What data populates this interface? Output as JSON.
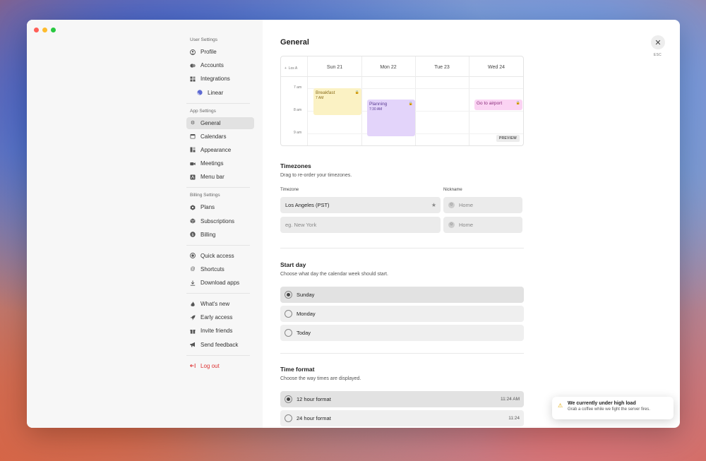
{
  "window": {
    "traffic_colors": [
      "#ff5f57",
      "#febc2e",
      "#28c840"
    ]
  },
  "sidebar": {
    "user_settings_title": "User Settings",
    "user_items": [
      {
        "label": "Profile",
        "icon": "person-icon"
      },
      {
        "label": "Accounts",
        "icon": "accounts-icon"
      },
      {
        "label": "Integrations",
        "icon": "grid-icon"
      },
      {
        "label": "Linear",
        "icon": "linear-icon"
      }
    ],
    "app_settings_title": "App Settings",
    "app_items": [
      {
        "label": "General",
        "icon": "gear-icon",
        "active": true
      },
      {
        "label": "Calendars",
        "icon": "calendar-icon"
      },
      {
        "label": "Appearance",
        "icon": "appearance-icon"
      },
      {
        "label": "Meetings",
        "icon": "video-icon"
      },
      {
        "label": "Menu bar",
        "icon": "menubar-icon"
      }
    ],
    "billing_settings_title": "Billing Settings",
    "billing_items": [
      {
        "label": "Plans",
        "icon": "plans-icon"
      },
      {
        "label": "Subscriptions",
        "icon": "box-icon"
      },
      {
        "label": "Billing",
        "icon": "dollar-icon"
      }
    ],
    "misc_items": [
      {
        "label": "Quick access",
        "icon": "globe-icon"
      },
      {
        "label": "Shortcuts",
        "icon": "at-icon"
      },
      {
        "label": "Download apps",
        "icon": "download-icon"
      }
    ],
    "community_items": [
      {
        "label": "What's new",
        "icon": "flame-icon"
      },
      {
        "label": "Early access",
        "icon": "rocket-icon"
      },
      {
        "label": "Invite friends",
        "icon": "gift-icon"
      },
      {
        "label": "Send feedback",
        "icon": "megaphone-icon"
      }
    ],
    "logout_label": "Log out"
  },
  "main": {
    "title": "General",
    "close_label": "ESC",
    "calendar": {
      "tz_label": "Los A",
      "days": [
        "Sun 21",
        "Mon 22",
        "Tue 23",
        "Wed 24"
      ],
      "hours": [
        "7 am",
        "8 am",
        "9 am"
      ],
      "events": [
        {
          "title": "Breakfast",
          "time": "7 AM"
        },
        {
          "title": "Planning",
          "time": "7:30 AM"
        },
        {
          "title": "Go to airport",
          "time": ""
        }
      ],
      "preview_label": "PREVIEW"
    },
    "timezones": {
      "title": "Timezones",
      "description": "Drag to re-order your timezones.",
      "timezone_label": "Timezone",
      "nickname_label": "Nickname",
      "row1_value": "Los Angeles (PST)",
      "row1_nickname_placeholder": "Home",
      "row2_placeholder": "eg. New York",
      "row2_nickname_placeholder": "Home"
    },
    "start_day": {
      "title": "Start day",
      "description": "Choose what day the calendar week should start.",
      "options": [
        "Sunday",
        "Monday",
        "Today"
      ],
      "selected": "Sunday"
    },
    "time_format": {
      "title": "Time format",
      "description": "Choose the way times are displayed.",
      "options": [
        {
          "label": "12 hour format",
          "example": "11:24 AM"
        },
        {
          "label": "24 hour format",
          "example": "11:24"
        }
      ],
      "selected": "12 hour format"
    }
  },
  "toast": {
    "title": "We currently under high load",
    "description": "Grab a coffee while we fight the server fires."
  }
}
